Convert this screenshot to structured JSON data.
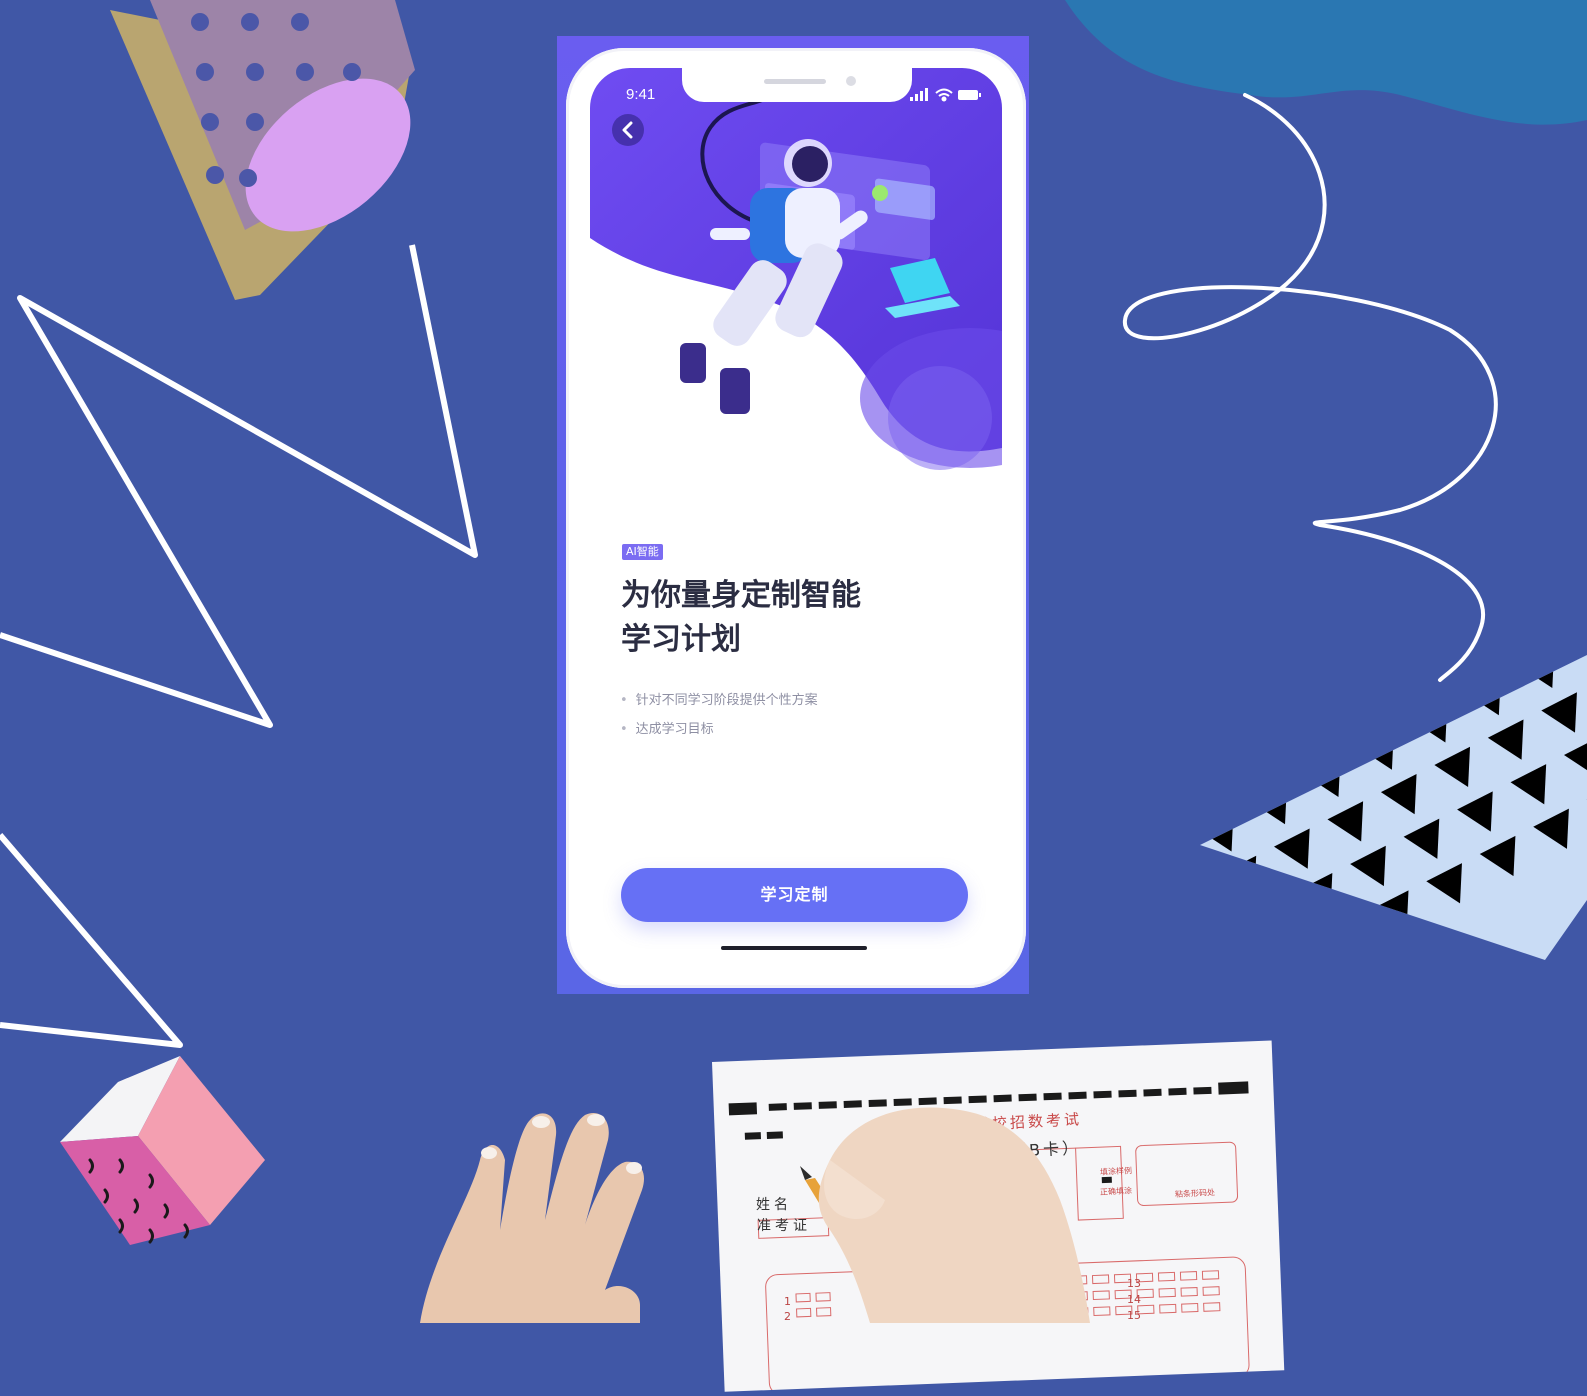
{
  "phone": {
    "status_time": "9:41",
    "badge": "AI智能",
    "title_line1": "为你量身定制智能",
    "title_line2": "学习计划",
    "bullets": [
      "针对不同学习阶段提供个性方案",
      "达成学习目标"
    ],
    "cta_label": "学习定制"
  },
  "answer_sheet": {
    "title": "高等学校招数考试",
    "subtitle": "（B卡）",
    "name_label": "姓名",
    "id_label": "准考证",
    "box_labels": [
      "填涂样例",
      "正确填涂",
      "粘条形码处"
    ],
    "numbers": [
      "13",
      "14",
      "15",
      "1",
      "2"
    ]
  },
  "colors": {
    "background": "#4057a6",
    "accent": "#6670f5",
    "badge": "#7b6cf2"
  },
  "icons": [
    "back-chevron-icon",
    "signal-icon",
    "wifi-icon",
    "battery-icon"
  ]
}
